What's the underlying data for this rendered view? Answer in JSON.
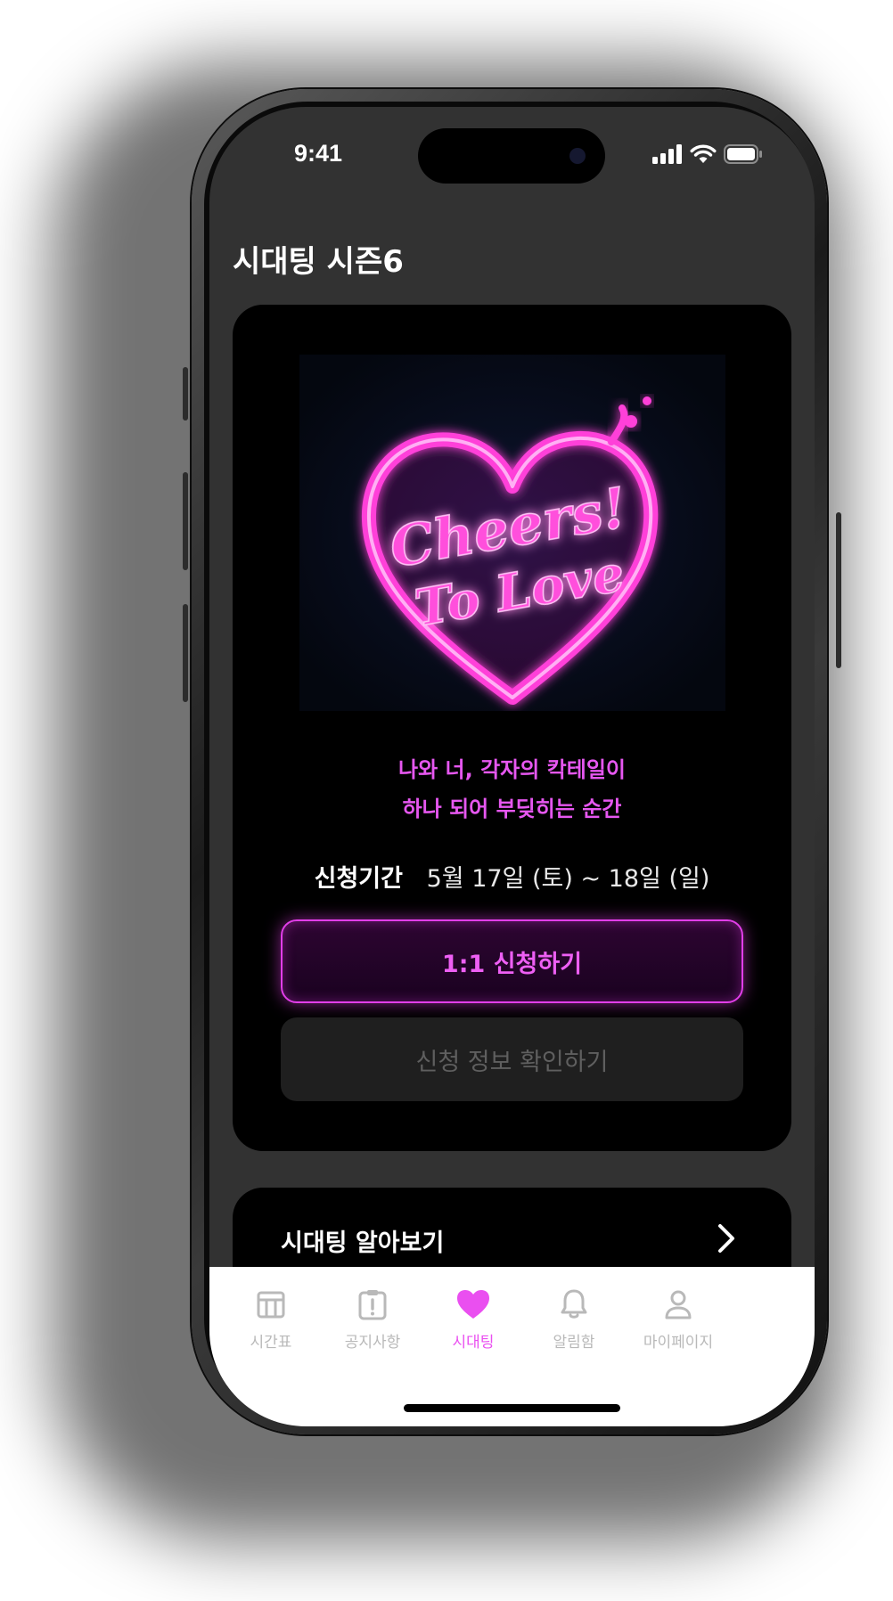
{
  "status_bar": {
    "time": "9:41"
  },
  "header": {
    "title": "시대팅 시즌6"
  },
  "event_card": {
    "poster": {
      "line1": "Cheers!",
      "line2": "To Love",
      "alt": "Cheers! To Love neon heart poster"
    },
    "tagline": [
      "나와 너, 각자의 칵테일이",
      "하나 되어 부딪히는 순간"
    ],
    "period_label": "신청기간",
    "period_value": "5월 17일 (토) ~ 18일 (일)",
    "apply_button": "1:1 신청하기",
    "check_button": "신청 정보 확인하기"
  },
  "info_card": {
    "label": "시대팅 알아보기"
  },
  "tabbar": {
    "items": [
      {
        "label": "시간표",
        "icon": "calendar-icon",
        "active": false
      },
      {
        "label": "공지사항",
        "icon": "notice-icon",
        "active": false
      },
      {
        "label": "시대팅",
        "icon": "heart-icon",
        "active": true
      },
      {
        "label": "알림함",
        "icon": "bell-icon",
        "active": false
      },
      {
        "label": "마이페이지",
        "icon": "person-icon",
        "active": false
      }
    ]
  },
  "colors": {
    "accent": "#ea4ff0",
    "background": "#323232",
    "card": "#000000",
    "tabbar": "#ffffff",
    "inactive_tab": "#b9b9b9"
  }
}
